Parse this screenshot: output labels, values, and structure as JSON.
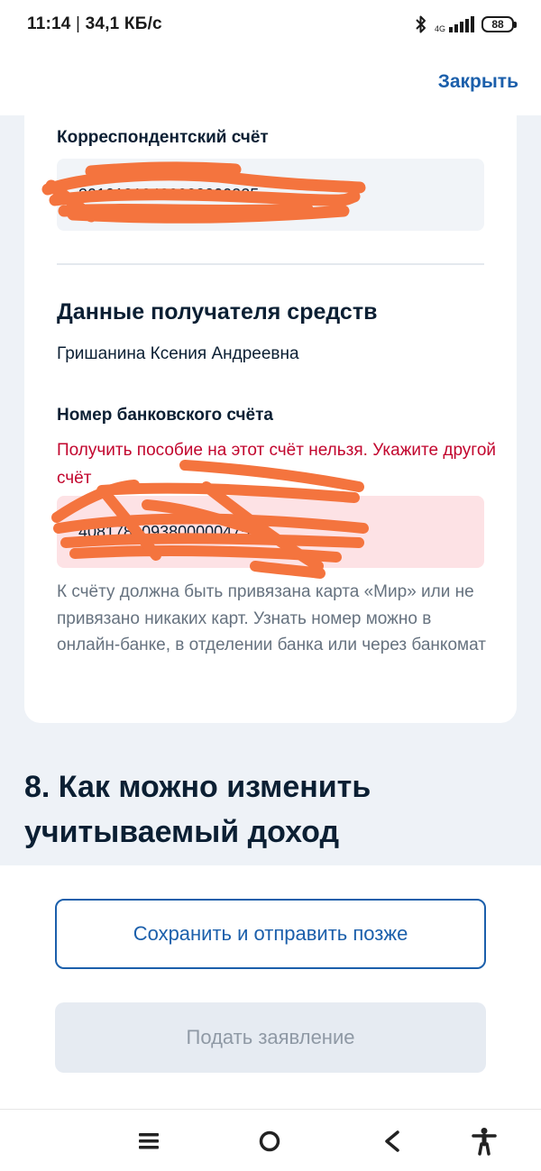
{
  "status_bar": {
    "time": "11:14",
    "separator": "|",
    "speed": "34,1 КБ/с",
    "network": "4G",
    "battery": "88"
  },
  "header": {
    "close_label": "Закрыть"
  },
  "bank": {
    "corr_account_label": "Корреспондентский счёт",
    "corr_account_value": "30101810400000000225"
  },
  "recipient": {
    "section_title": "Данные получателя средств",
    "name": "Гришанина Ксения Андреевна",
    "account_label": "Номер банковского счёта",
    "error_message": "Получить пособие на этот счёт нельзя. Укажите другой счёт",
    "account_value": "40817810938000004752",
    "hint": "К счёту должна быть привязана карта «Мир» или не привязано никаких карт. Узнать номер можно в онлайн-банке, в отделении банка или через банкомат"
  },
  "step": {
    "title": "8. Как можно изменить учитываемый доход"
  },
  "actions": {
    "save_later_label": "Сохранить и отправить позже",
    "submit_label": "Подать заявление"
  },
  "nav": {
    "icons": [
      "menu-icon",
      "home-circle-icon",
      "back-icon",
      "accessibility-icon"
    ]
  },
  "colors": {
    "accent": "#1b5fab",
    "error": "#c2062e",
    "error_bg": "#fde2e5",
    "redaction": "#f4743e"
  }
}
